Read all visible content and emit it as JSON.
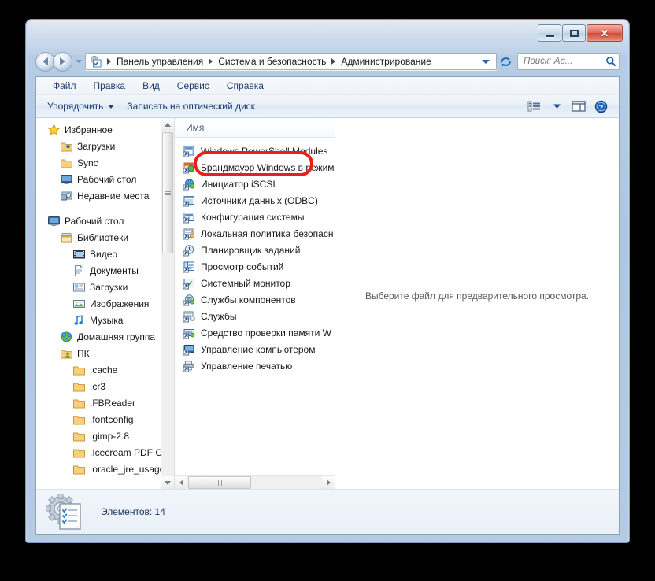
{
  "window": {
    "controls": {
      "minimize": "—",
      "maximize": "❐",
      "close": "✕"
    }
  },
  "address": {
    "back_label": "Назад",
    "forward_label": "Вперед",
    "history_label": "Последние страницы",
    "crumbs": [
      "Панель управления",
      "Система и безопасность",
      "Администрирование"
    ],
    "dropdown_label": "Предыдущие папки",
    "refresh_label": "Обновить"
  },
  "search": {
    "placeholder": "Поиск: Ад...",
    "value": "",
    "icon": "search-icon"
  },
  "menu": {
    "items": [
      "Файл",
      "Правка",
      "Вид",
      "Сервис",
      "Справка"
    ]
  },
  "toolbar": {
    "organize_label": "Упорядочить",
    "burn_label": "Записать на оптический диск",
    "view_label": "Изменить представление",
    "preview_label": "Отобразить область предварительного просмотра",
    "help_label": "Справка"
  },
  "sidebar": {
    "groups": [
      {
        "items": [
          {
            "label": "Избранное",
            "icon": "star-icon",
            "level": 0
          },
          {
            "label": "Загрузки",
            "icon": "downloads-folder-icon",
            "level": 1
          },
          {
            "label": "Sync",
            "icon": "folder-icon",
            "level": 1
          },
          {
            "label": "Рабочий стол",
            "icon": "desktop-icon",
            "level": 1
          },
          {
            "label": "Недавние места",
            "icon": "recent-places-icon",
            "level": 1
          }
        ]
      },
      {
        "items": [
          {
            "label": "Рабочий стол",
            "icon": "desktop-icon",
            "level": 0
          },
          {
            "label": "Библиотеки",
            "icon": "libraries-icon",
            "level": 1
          },
          {
            "label": "Видео",
            "icon": "video-library-icon",
            "level": 2
          },
          {
            "label": "Документы",
            "icon": "documents-library-icon",
            "level": 2
          },
          {
            "label": "Загрузки",
            "icon": "downloads-library-icon",
            "level": 2
          },
          {
            "label": "Изображения",
            "icon": "pictures-library-icon",
            "level": 2
          },
          {
            "label": "Музыка",
            "icon": "music-library-icon",
            "level": 2
          },
          {
            "label": "Домашняя группа",
            "icon": "homegroup-icon",
            "level": 1
          },
          {
            "label": "ПК",
            "icon": "user-folder-icon",
            "level": 1
          },
          {
            "label": ".cache",
            "icon": "folder-icon",
            "level": 2
          },
          {
            "label": ".cr3",
            "icon": "folder-icon",
            "level": 2
          },
          {
            "label": ".FBReader",
            "icon": "folder-icon",
            "level": 2
          },
          {
            "label": ".fontconfig",
            "icon": "folder-icon",
            "level": 2
          },
          {
            "label": ".gimp-2.8",
            "icon": "folder-icon",
            "level": 2
          },
          {
            "label": ".Icecream PDF Conver",
            "icon": "folder-icon",
            "level": 2
          },
          {
            "label": ".oracle_jre_usage",
            "icon": "folder-icon",
            "level": 2
          }
        ]
      }
    ]
  },
  "filelist": {
    "column_header": "Имя",
    "items": [
      {
        "label": "Windows PowerShell Modules",
        "icon": "shortcut-icon"
      },
      {
        "label": "Брандмауэр Windows в режим",
        "icon": "firewall-shortcut-icon"
      },
      {
        "label": "Инициатор iSCSI",
        "icon": "iscsi-shortcut-icon"
      },
      {
        "label": "Источники данных (ODBC)",
        "icon": "odbc-shortcut-icon"
      },
      {
        "label": "Конфигурация системы",
        "icon": "msconfig-shortcut-icon"
      },
      {
        "label": "Локальная политика безопасн",
        "icon": "security-policy-shortcut-icon"
      },
      {
        "label": "Планировщик заданий",
        "icon": "task-scheduler-shortcut-icon"
      },
      {
        "label": "Просмотр событий",
        "icon": "event-viewer-shortcut-icon",
        "highlighted": true
      },
      {
        "label": "Системный монитор",
        "icon": "perfmon-shortcut-icon"
      },
      {
        "label": "Службы компонентов",
        "icon": "component-services-shortcut-icon"
      },
      {
        "label": "Службы",
        "icon": "services-shortcut-icon"
      },
      {
        "label": "Средство проверки памяти W",
        "icon": "memory-diagnostic-shortcut-icon"
      },
      {
        "label": "Управление компьютером",
        "icon": "computer-management-shortcut-icon"
      },
      {
        "label": "Управление печатью",
        "icon": "print-management-shortcut-icon"
      }
    ]
  },
  "preview": {
    "message": "Выберите файл для предварительного просмотра."
  },
  "status": {
    "count_label": "Элементов: 14",
    "icon": "administrative-tools-icon"
  },
  "annotation": {
    "shape": "ellipse",
    "color": "#e8201a",
    "target": "Просмотр событий"
  }
}
